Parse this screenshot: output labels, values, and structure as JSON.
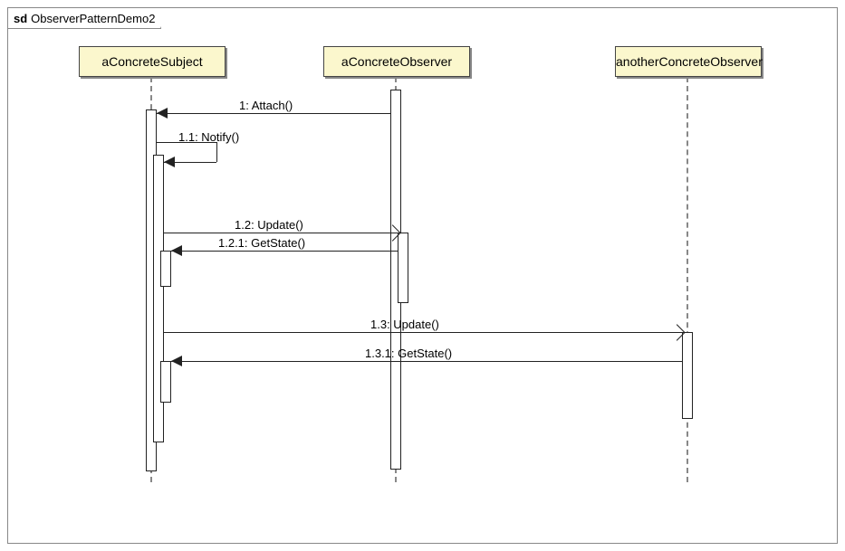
{
  "frame": {
    "prefix": "sd",
    "name": "ObserverPatternDemo2"
  },
  "lifelines": {
    "subject": "aConcreteSubject",
    "observer1": "aConcreteObserver",
    "observer2": "anotherConcreteObserver"
  },
  "messages": {
    "m1": "1: Attach()",
    "m11": "1.1: Notify()",
    "m12": "1.2: Update()",
    "m121": "1.2.1: GetState()",
    "m13": "1.3: Update()",
    "m131": "1.3.1: GetState()"
  }
}
